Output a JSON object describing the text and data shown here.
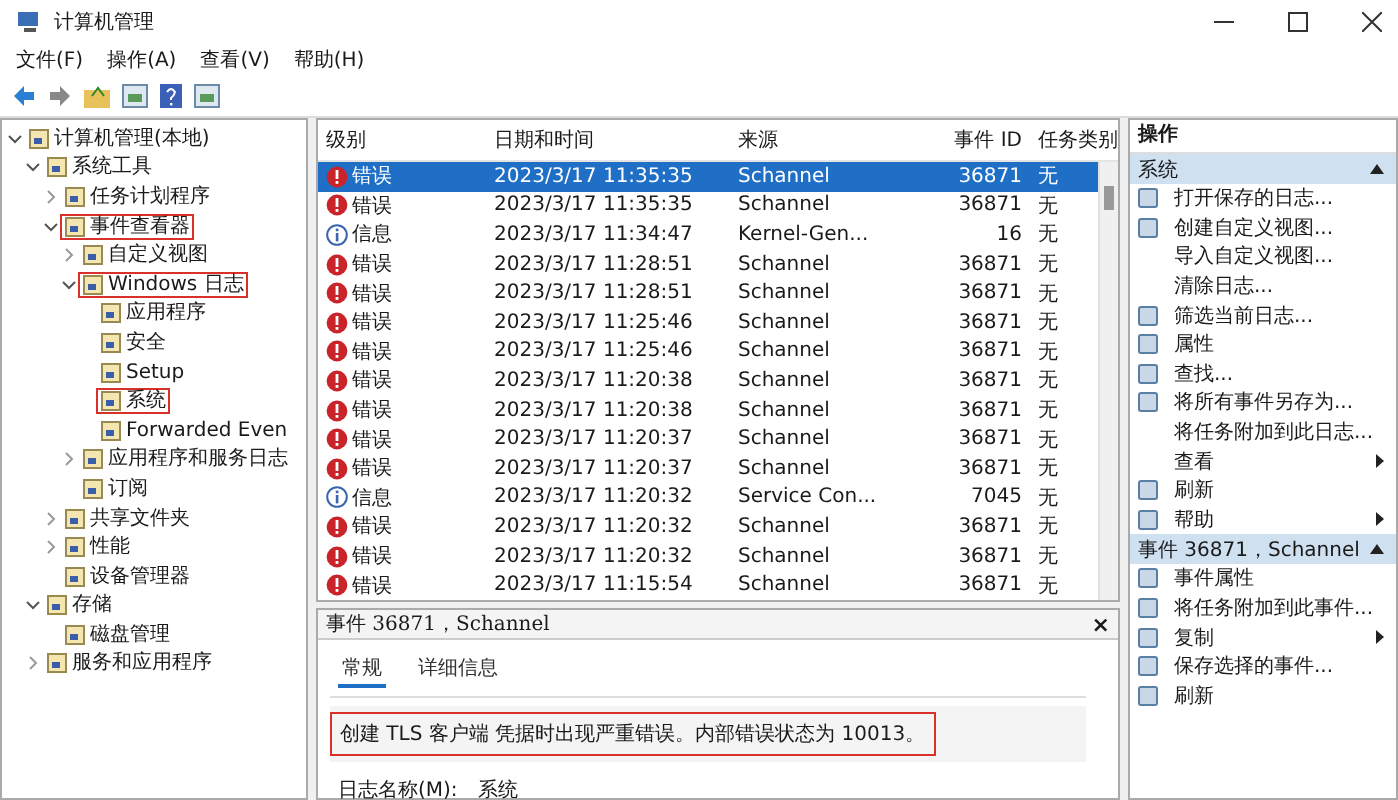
{
  "window": {
    "title": "计算机管理"
  },
  "menu": [
    "文件(F)",
    "操作(A)",
    "查看(V)",
    "帮助(H)"
  ],
  "tree": [
    {
      "label": "计算机管理(本地)",
      "expanded": true,
      "annotated": false,
      "children": [
        {
          "label": "系统工具",
          "expanded": true,
          "annotated": false,
          "children": [
            {
              "label": "任务计划程序",
              "expanded": false,
              "annotated": false
            },
            {
              "label": "事件查看器",
              "expanded": true,
              "annotated": true,
              "children": [
                {
                  "label": "自定义视图",
                  "expanded": false,
                  "annotated": false
                },
                {
                  "label": "Windows 日志",
                  "expanded": true,
                  "annotated": true,
                  "children": [
                    {
                      "label": "应用程序",
                      "annotated": false
                    },
                    {
                      "label": "安全",
                      "annotated": false
                    },
                    {
                      "label": "Setup",
                      "annotated": false
                    },
                    {
                      "label": "系统",
                      "annotated": true
                    },
                    {
                      "label": "Forwarded Even",
                      "annotated": false
                    }
                  ]
                },
                {
                  "label": "应用程序和服务日志",
                  "expanded": false,
                  "annotated": false
                },
                {
                  "label": "订阅",
                  "annotated": false
                }
              ]
            },
            {
              "label": "共享文件夹",
              "expanded": false,
              "annotated": false
            },
            {
              "label": "性能",
              "expanded": false,
              "annotated": false
            },
            {
              "label": "设备管理器",
              "annotated": false
            }
          ]
        },
        {
          "label": "存储",
          "expanded": true,
          "annotated": false,
          "children": [
            {
              "label": "磁盘管理",
              "annotated": false
            }
          ]
        },
        {
          "label": "服务和应用程序",
          "expanded": false,
          "annotated": false
        }
      ]
    }
  ],
  "table": {
    "columns": [
      "级别",
      "日期和时间",
      "来源",
      "事件 ID",
      "任务类别"
    ],
    "rows": [
      {
        "kind": "error",
        "level": "错误",
        "time": "2023/3/17 11:35:35",
        "source": "Schannel",
        "id": "36871",
        "category": "无",
        "selected": true
      },
      {
        "kind": "error",
        "level": "错误",
        "time": "2023/3/17 11:35:35",
        "source": "Schannel",
        "id": "36871",
        "category": "无",
        "selected": false
      },
      {
        "kind": "info",
        "level": "信息",
        "time": "2023/3/17 11:34:47",
        "source": "Kernel-Gen...",
        "id": "16",
        "category": "无",
        "selected": false
      },
      {
        "kind": "error",
        "level": "错误",
        "time": "2023/3/17 11:28:51",
        "source": "Schannel",
        "id": "36871",
        "category": "无",
        "selected": false
      },
      {
        "kind": "error",
        "level": "错误",
        "time": "2023/3/17 11:28:51",
        "source": "Schannel",
        "id": "36871",
        "category": "无",
        "selected": false
      },
      {
        "kind": "error",
        "level": "错误",
        "time": "2023/3/17 11:25:46",
        "source": "Schannel",
        "id": "36871",
        "category": "无",
        "selected": false
      },
      {
        "kind": "error",
        "level": "错误",
        "time": "2023/3/17 11:25:46",
        "source": "Schannel",
        "id": "36871",
        "category": "无",
        "selected": false
      },
      {
        "kind": "error",
        "level": "错误",
        "time": "2023/3/17 11:20:38",
        "source": "Schannel",
        "id": "36871",
        "category": "无",
        "selected": false
      },
      {
        "kind": "error",
        "level": "错误",
        "time": "2023/3/17 11:20:38",
        "source": "Schannel",
        "id": "36871",
        "category": "无",
        "selected": false
      },
      {
        "kind": "error",
        "level": "错误",
        "time": "2023/3/17 11:20:37",
        "source": "Schannel",
        "id": "36871",
        "category": "无",
        "selected": false
      },
      {
        "kind": "error",
        "level": "错误",
        "time": "2023/3/17 11:20:37",
        "source": "Schannel",
        "id": "36871",
        "category": "无",
        "selected": false
      },
      {
        "kind": "info",
        "level": "信息",
        "time": "2023/3/17 11:20:32",
        "source": "Service Con...",
        "id": "7045",
        "category": "无",
        "selected": false
      },
      {
        "kind": "error",
        "level": "错误",
        "time": "2023/3/17 11:20:32",
        "source": "Schannel",
        "id": "36871",
        "category": "无",
        "selected": false
      },
      {
        "kind": "error",
        "level": "错误",
        "time": "2023/3/17 11:20:32",
        "source": "Schannel",
        "id": "36871",
        "category": "无",
        "selected": false
      },
      {
        "kind": "error",
        "level": "错误",
        "time": "2023/3/17 11:15:54",
        "source": "Schannel",
        "id": "36871",
        "category": "无",
        "selected": false
      }
    ]
  },
  "detail": {
    "title": "事件 36871，Schannel",
    "close": "×",
    "tabs": [
      {
        "label": "常规",
        "selected": true
      },
      {
        "label": "详细信息",
        "selected": false
      }
    ],
    "message": "创建 TLS 客户端 凭据时出现严重错误。内部错误状态为 10013。",
    "message_annotated": true,
    "fields": [
      {
        "label": "日志名称(M):",
        "value": "系统"
      }
    ]
  },
  "actions": {
    "title": "操作",
    "sections": [
      {
        "title": "系统",
        "expanded": true,
        "items": [
          {
            "label": "打开保存的日志...",
            "icon": true,
            "submenu": false
          },
          {
            "label": "创建自定义视图...",
            "icon": true,
            "submenu": false
          },
          {
            "label": "导入自定义视图...",
            "icon": false,
            "submenu": false
          },
          {
            "label": "清除日志...",
            "icon": false,
            "submenu": false
          },
          {
            "label": "筛选当前日志...",
            "icon": true,
            "submenu": false
          },
          {
            "label": "属性",
            "icon": true,
            "submenu": false
          },
          {
            "label": "查找...",
            "icon": true,
            "submenu": false
          },
          {
            "label": "将所有事件另存为...",
            "icon": true,
            "submenu": false
          },
          {
            "label": "将任务附加到此日志...",
            "icon": false,
            "submenu": false
          },
          {
            "label": "查看",
            "icon": false,
            "submenu": true
          },
          {
            "label": "刷新",
            "icon": true,
            "submenu": false
          },
          {
            "label": "帮助",
            "icon": true,
            "submenu": true
          }
        ]
      },
      {
        "title": "事件 36871，Schannel",
        "expanded": true,
        "items": [
          {
            "label": "事件属性",
            "icon": true,
            "submenu": false
          },
          {
            "label": "将任务附加到此事件...",
            "icon": true,
            "submenu": false
          },
          {
            "label": "复制",
            "icon": true,
            "submenu": true
          },
          {
            "label": "保存选择的事件...",
            "icon": true,
            "submenu": false
          },
          {
            "label": "刷新",
            "icon": true,
            "submenu": false
          }
        ]
      }
    ]
  }
}
